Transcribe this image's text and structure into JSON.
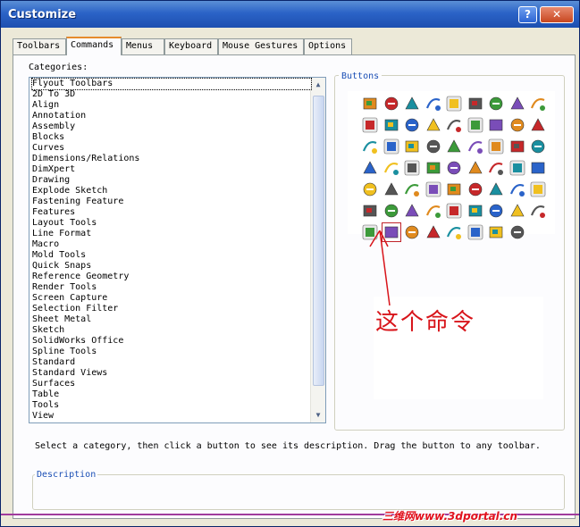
{
  "window": {
    "title": "Customize",
    "help_glyph": "?",
    "close_glyph": "✕"
  },
  "tabs": [
    "Toolbars",
    "Commands",
    "Menus",
    "Keyboard",
    "Mouse Gestures",
    "Options"
  ],
  "active_tab": "Commands",
  "categories_label": "Categories:",
  "categories": [
    "Flyout Toolbars",
    "2D To 3D",
    "Align",
    "Annotation",
    "Assembly",
    "Blocks",
    "Curves",
    "Dimensions/Relations",
    "DimXpert",
    "Drawing",
    "Explode Sketch",
    "Fastening Feature",
    "Features",
    "Layout Tools",
    "Line Format",
    "Macro",
    "Mold Tools",
    "Quick Snaps",
    "Reference Geometry",
    "Render Tools",
    "Screen Capture",
    "Selection Filter",
    "Sheet Metal",
    "Sketch",
    "SolidWorks Office",
    "Spline Tools",
    "Standard",
    "Standard Views",
    "Surfaces",
    "Table",
    "Tools",
    "View"
  ],
  "selected_category": "Flyout Toolbars",
  "buttons_label": "Buttons",
  "highlighted_button": "row7-btn2",
  "annotation_text": "这个命令",
  "annotation_color": "#d8141a",
  "hint": "Select a category, then click a button to see its description. Drag the button to any toolbar.",
  "description_label": "Description",
  "watermark": "三维网www.3dportal.cn",
  "colors": {
    "title_bar": "#2b63c7",
    "accent_tab": "#e68b2c",
    "group_label": "#1b4fb5"
  }
}
